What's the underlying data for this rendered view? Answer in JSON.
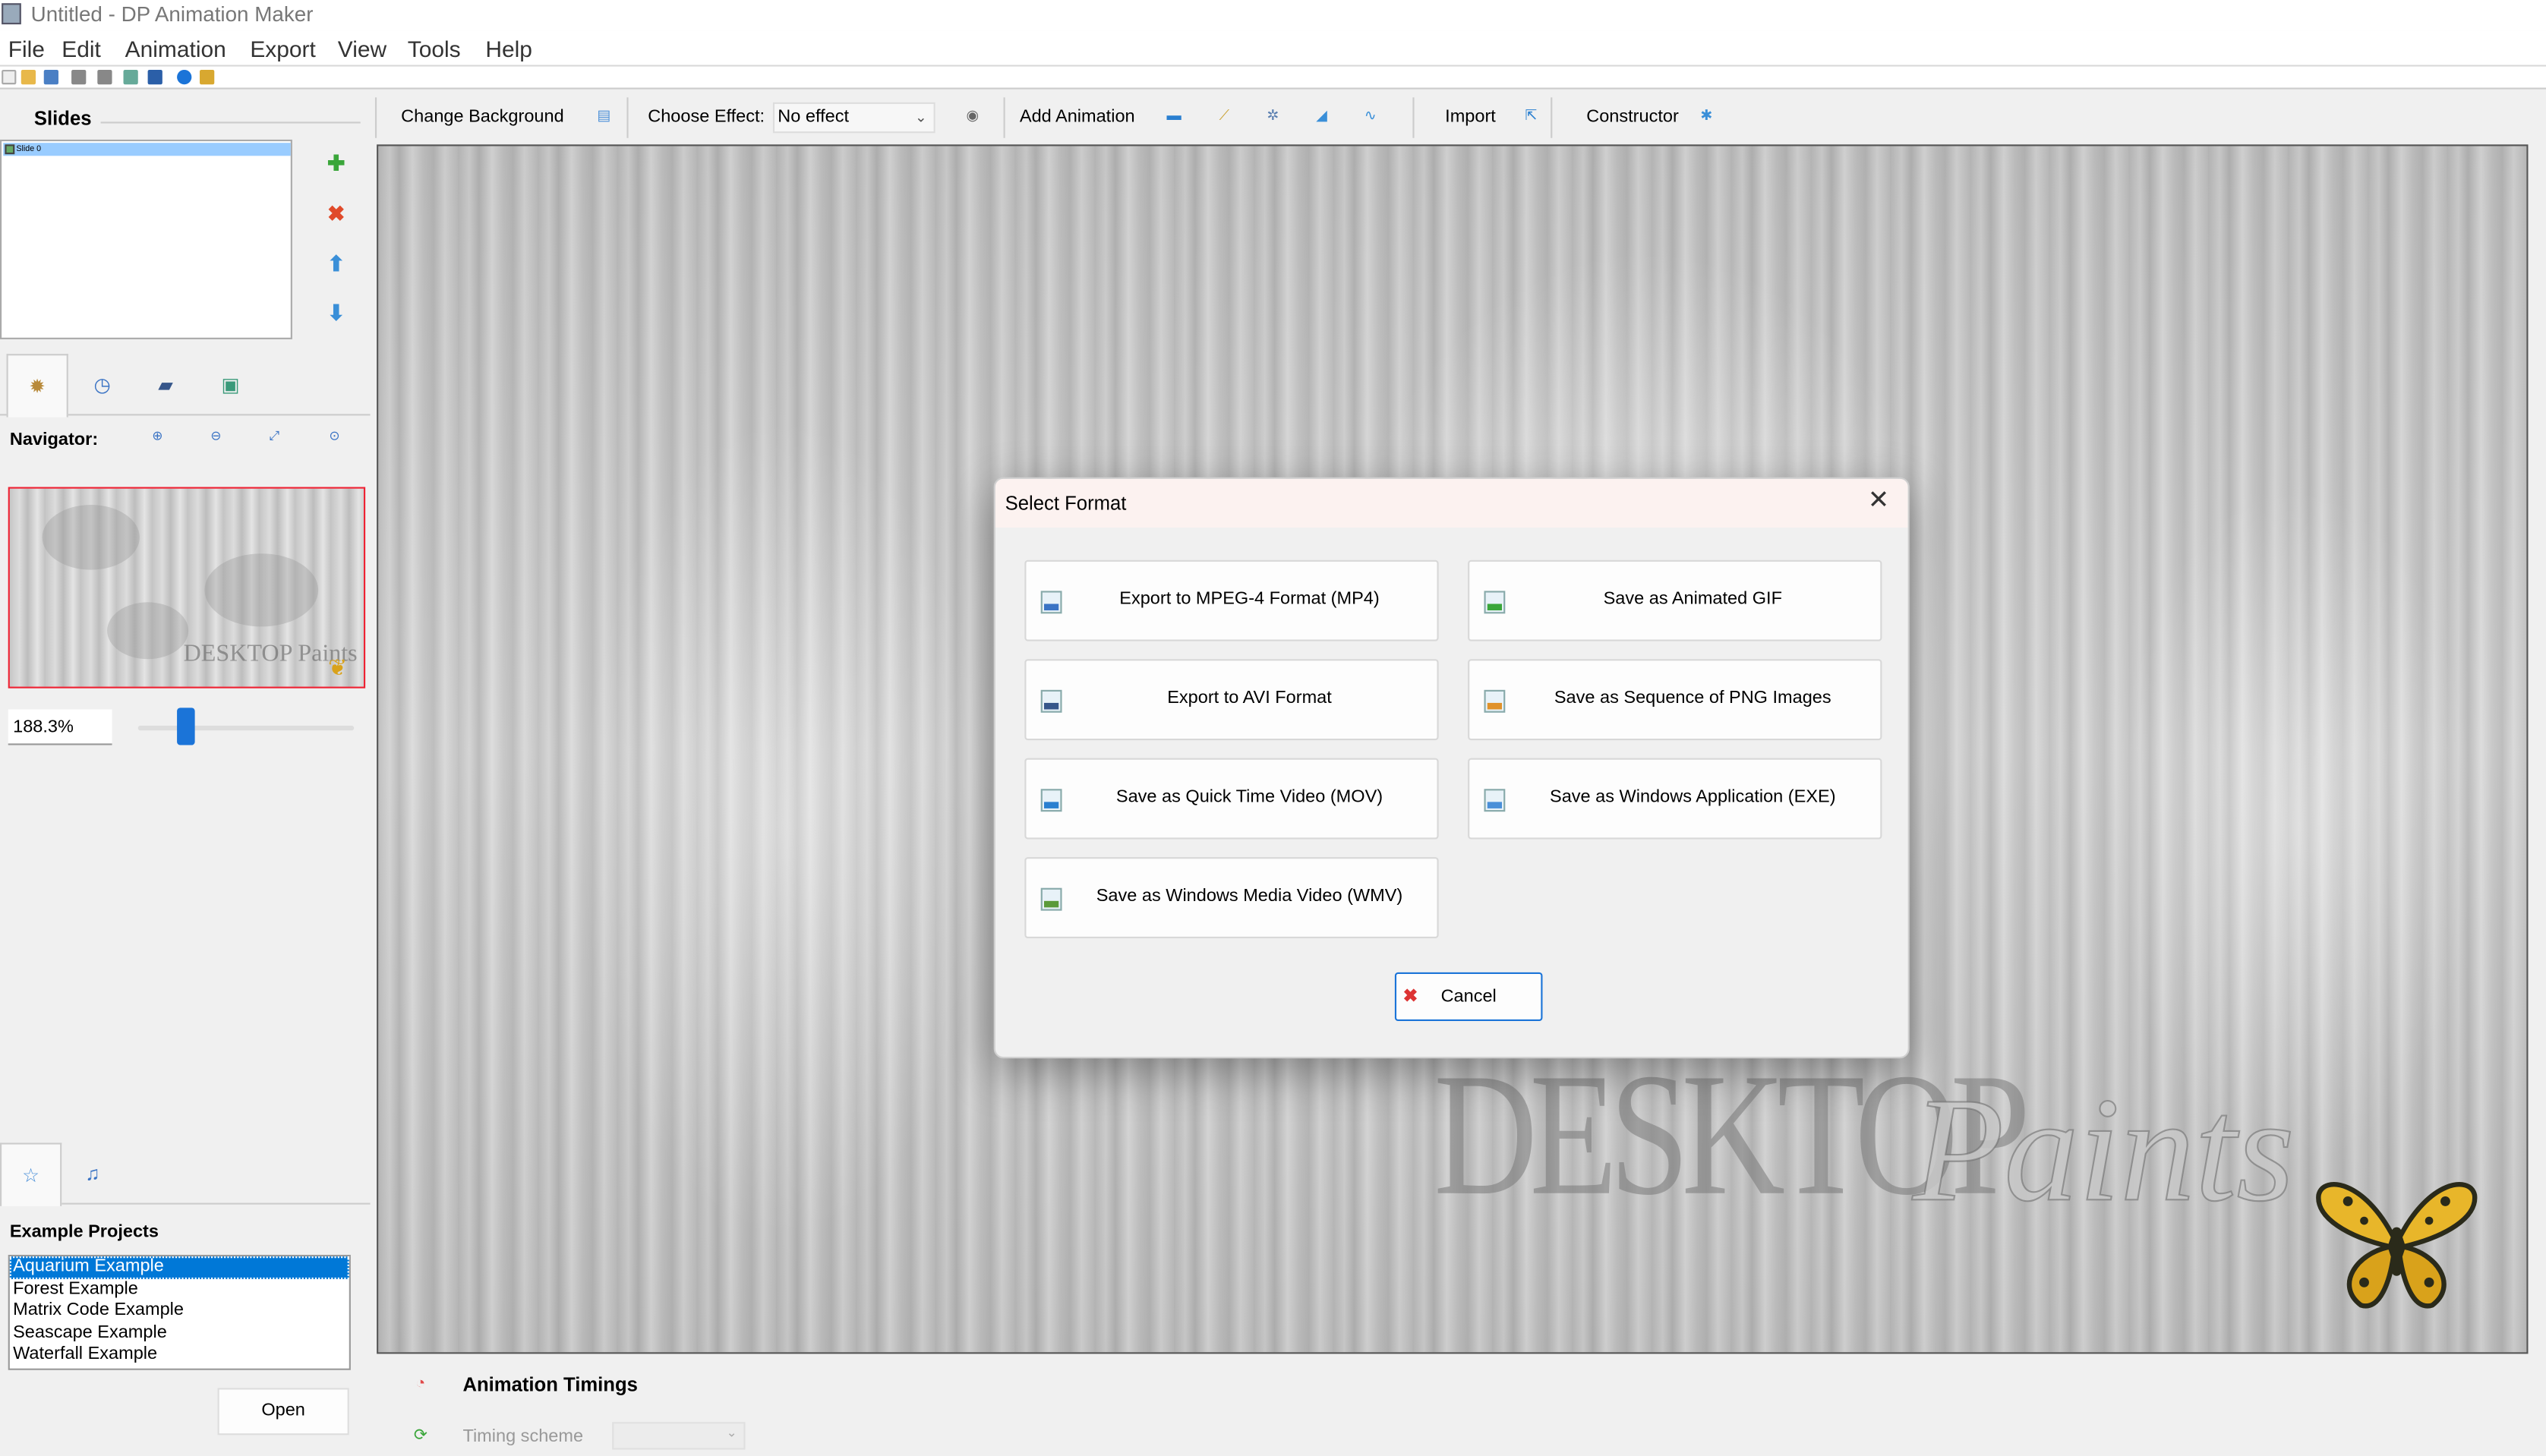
{
  "window": {
    "title": "Untitled - DP Animation Maker"
  },
  "menu": [
    "File",
    "Edit",
    "Animation",
    "Export",
    "View",
    "Tools",
    "Help"
  ],
  "slides": {
    "title": "Slides",
    "items": [
      "Slide 0"
    ]
  },
  "navigator": {
    "label": "Navigator:",
    "zoom": "188.3%",
    "zoom_slider_fraction": 0.2,
    "watermark": "DESKTOP Paints"
  },
  "toolbar": {
    "change_background": "Change Background",
    "choose_effect": "Choose Effect:",
    "effect_value": "No effect",
    "add_animation": "Add Animation",
    "import": "Import",
    "constructor": "Constructor"
  },
  "examples": {
    "title": "Example Projects",
    "items": [
      "Aquarium Example",
      "Forest Example",
      "Matrix Code Example",
      "Seascape Example",
      "Waterfall Example"
    ],
    "selected_index": 0,
    "open_label": "Open"
  },
  "canvas": {
    "watermark_word1": "DESKTOP",
    "watermark_word2": "Paints"
  },
  "timings": {
    "title": "Animation Timings",
    "scheme_label": "Timing scheme",
    "scheme_value": ""
  },
  "dialog": {
    "title": "Select Format",
    "close_symbol": "✕",
    "buttons": [
      {
        "label": "Export to MPEG-4 Format (MP4)",
        "icon": "mp4-file-icon"
      },
      {
        "label": "Save as Animated GIF",
        "icon": "gif-file-icon"
      },
      {
        "label": "Export to AVI Format",
        "icon": "avi-file-icon"
      },
      {
        "label": "Save as Sequence of PNG Images",
        "icon": "png-file-icon"
      },
      {
        "label": "Save as Quick Time Video (MOV)",
        "icon": "mov-file-icon"
      },
      {
        "label": "Save as Windows Application (EXE)",
        "icon": "exe-file-icon"
      },
      {
        "label": "Save as Windows Media Video (WMV)",
        "icon": "wmv-file-icon"
      }
    ],
    "cancel_label": "Cancel"
  },
  "colors": {
    "accent": "#0078d7",
    "slider": "#1b74d8",
    "selection": "#99ccff",
    "preview_border": "#e23333",
    "dialog_titlebar": "#fcf2f0"
  }
}
